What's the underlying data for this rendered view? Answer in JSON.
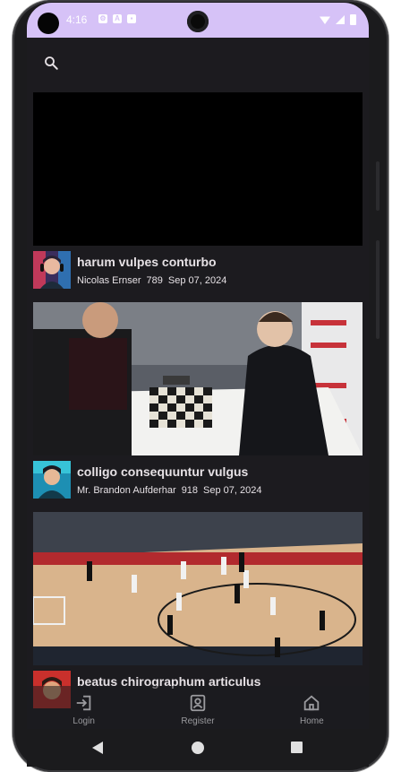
{
  "status_bar": {
    "time": "4:16",
    "indicator_labels": [
      "⚙",
      "A",
      "▪"
    ]
  },
  "search": {
    "icon": "search-icon"
  },
  "videos": [
    {
      "title": "harum vulpes conturbo",
      "author": "Nicolas Ernser",
      "views": "789",
      "date": "Sep 07, 2024"
    },
    {
      "title": "colligo consequuntur vulgus",
      "author": "Mr. Brandon Aufderhar",
      "views": "918",
      "date": "Sep 07, 2024"
    },
    {
      "title": "beatus chirographum articulus",
      "author": "",
      "views": "",
      "date": ""
    }
  ],
  "bottom_nav": [
    {
      "label": "Login",
      "icon": "login-icon"
    },
    {
      "label": "Register",
      "icon": "register-icon"
    },
    {
      "label": "Home",
      "icon": "home-icon"
    }
  ],
  "colors": {
    "status_bar": "#d6c2f7",
    "background": "#1c1b1f",
    "text": "#e6e1e5"
  }
}
